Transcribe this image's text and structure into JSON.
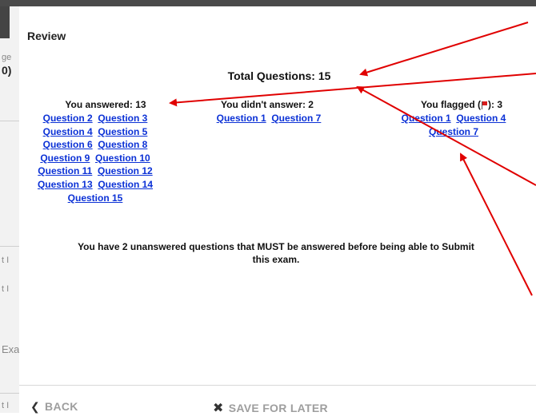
{
  "sidebar": {
    "fragments": [
      "ge",
      "0)",
      "t I",
      "t I",
      "Exa",
      "t I"
    ]
  },
  "review": {
    "title": "Review",
    "total": "Total Questions: 15",
    "answered_label": "You answered: 13",
    "unanswered_label": "You didn't answer: 2",
    "flagged_label_before": "You flagged (",
    "flagged_label_after": "): 3",
    "answered_rows": [
      [
        "Question 2",
        "Question 3"
      ],
      [
        "Question 4",
        "Question 5"
      ],
      [
        "Question 6",
        "Question 8"
      ],
      [
        "Question 9",
        "Question 10"
      ],
      [
        "Question 11",
        "Question 12"
      ],
      [
        "Question 13",
        "Question 14"
      ],
      [
        "Question 15"
      ]
    ],
    "unanswered_rows": [
      [
        "Question 1",
        "Question 7"
      ]
    ],
    "flagged_rows": [
      [
        "Question 1",
        "Question 4"
      ],
      [
        "Question 7"
      ]
    ],
    "message_line1": "You have 2 unanswered questions that MUST be answered before being able to Submit",
    "message_line2": "this exam."
  },
  "footer": {
    "back_label": "BACK",
    "save_later_label": "SAVE FOR LATER"
  },
  "icons": {
    "back": "chevron-left-icon",
    "save_later": "close-icon",
    "flag": "flag-icon"
  },
  "colors": {
    "link": "#0b31d6",
    "annotation_arrow": "#e00000",
    "footer_text": "#9e9e9e"
  }
}
